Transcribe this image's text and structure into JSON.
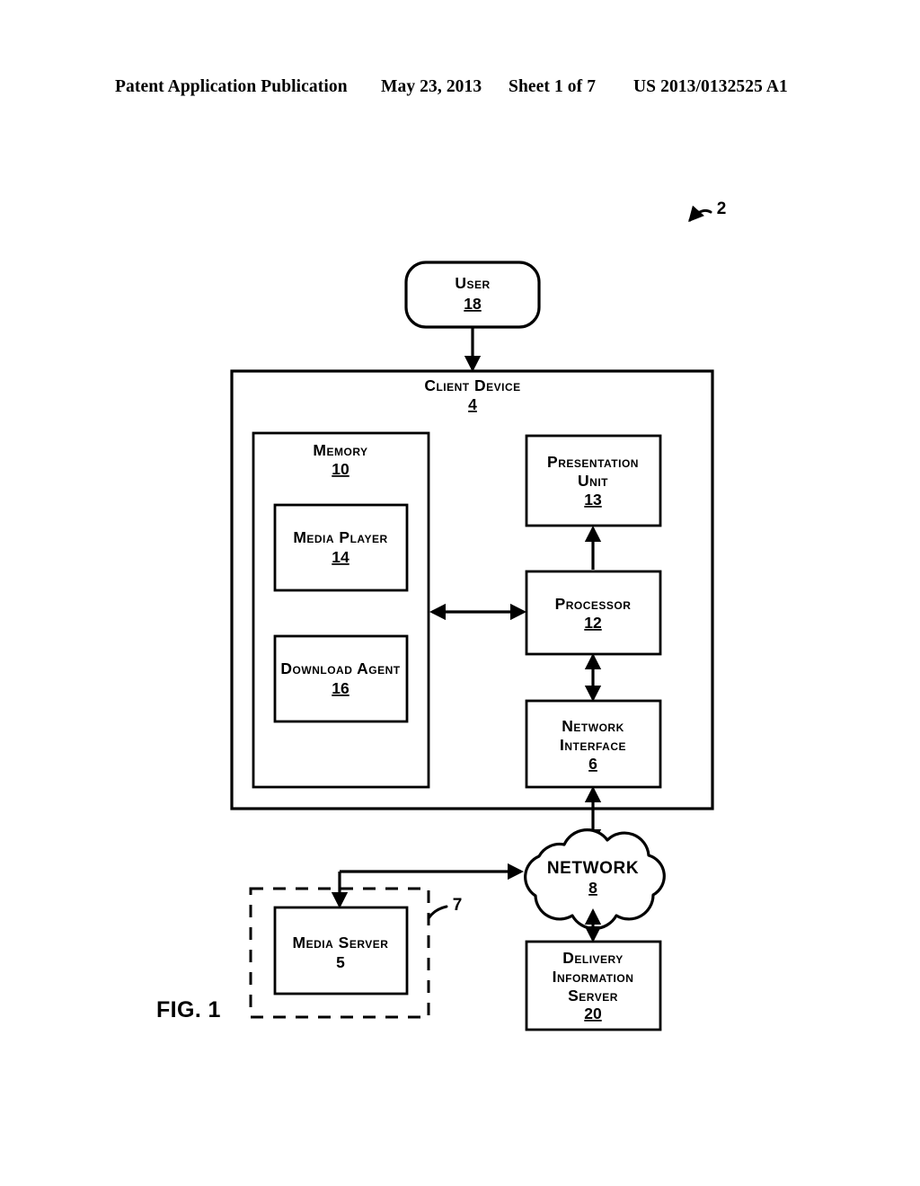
{
  "header": {
    "publication": "Patent Application Publication",
    "date": "May 23, 2013",
    "sheet": "Sheet 1 of 7",
    "doc_number": "US 2013/0132525 A1"
  },
  "figure": {
    "caption": "FIG. 1",
    "system_callout": "2",
    "group_callout": "7"
  },
  "nodes": {
    "user": {
      "label": "User",
      "ref": "18"
    },
    "client_device": {
      "label": "Client Device",
      "ref": "4"
    },
    "memory": {
      "label": "Memory",
      "ref": "10"
    },
    "media_player": {
      "label": "Media Player",
      "ref": "14"
    },
    "download_agent": {
      "label": "Download Agent",
      "ref": "16"
    },
    "presentation_unit": {
      "label_line1": "Presentation",
      "label_line2": "Unit",
      "ref": "13"
    },
    "processor": {
      "label": "Processor",
      "ref": "12"
    },
    "network_interface": {
      "label_line1": "Network",
      "label_line2": "Interface",
      "ref": "6"
    },
    "network": {
      "label": "NETWORK",
      "ref": "8"
    },
    "media_server": {
      "label": "Media Server",
      "ref": "5"
    },
    "delivery_information_server": {
      "label_line1": "Delivery",
      "label_line2": "Information",
      "label_line3": "Server",
      "ref": "20"
    }
  },
  "colors": {
    "ink": "#000000",
    "paper": "#ffffff"
  }
}
